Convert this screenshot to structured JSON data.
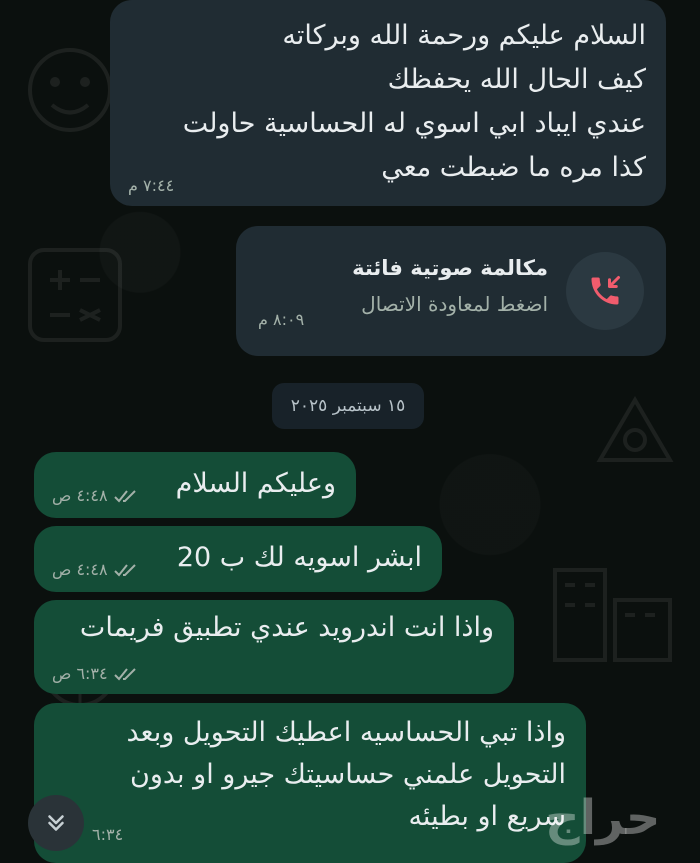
{
  "messages": {
    "m1": {
      "lines": [
        "السلام عليكم ورحمة الله وبركاته",
        "كيف الحال الله يحفظك",
        "عندي ايباد ابي اسوي له الحساسية حاولت",
        "كذا مره ما ضبطت معي"
      ],
      "time": "٧:٤٤ م"
    },
    "call": {
      "title": "مكالمة صوتية فائتة",
      "subtitle": "اضغط لمعاودة الاتصال",
      "time": "٨:٠٩ م"
    },
    "date_chip": "١٥ سبتمبر ٢٠٢٥",
    "m2": {
      "text": "وعليكم السلام",
      "time": "٤:٤٨ ص"
    },
    "m3": {
      "text": "ابشر اسويه لك ب 20",
      "time": "٤:٤٨ ص"
    },
    "m4": {
      "text": "واذا انت اندرويد عندي تطبيق فريمات",
      "time": "٦:٣٤ ص"
    },
    "m5": {
      "lines": [
        "واذا تبي الحساسيه اعطيك التحويل وبعد",
        "التحويل علمني حساسيتك جيرو او بدون",
        "سريع او بطيئه"
      ],
      "time": "٦:٣٤"
    }
  },
  "watermark": "حراج",
  "icons": {
    "missed_call": "missed-call-icon",
    "read_receipt": "double-check-icon",
    "scroll_down": "double-chevron-down-icon"
  },
  "colors": {
    "background": "#0b100e",
    "incoming_bubble": "#202c33",
    "outgoing_bubble": "#144d37",
    "missed_call_red": "#f15c6d"
  }
}
